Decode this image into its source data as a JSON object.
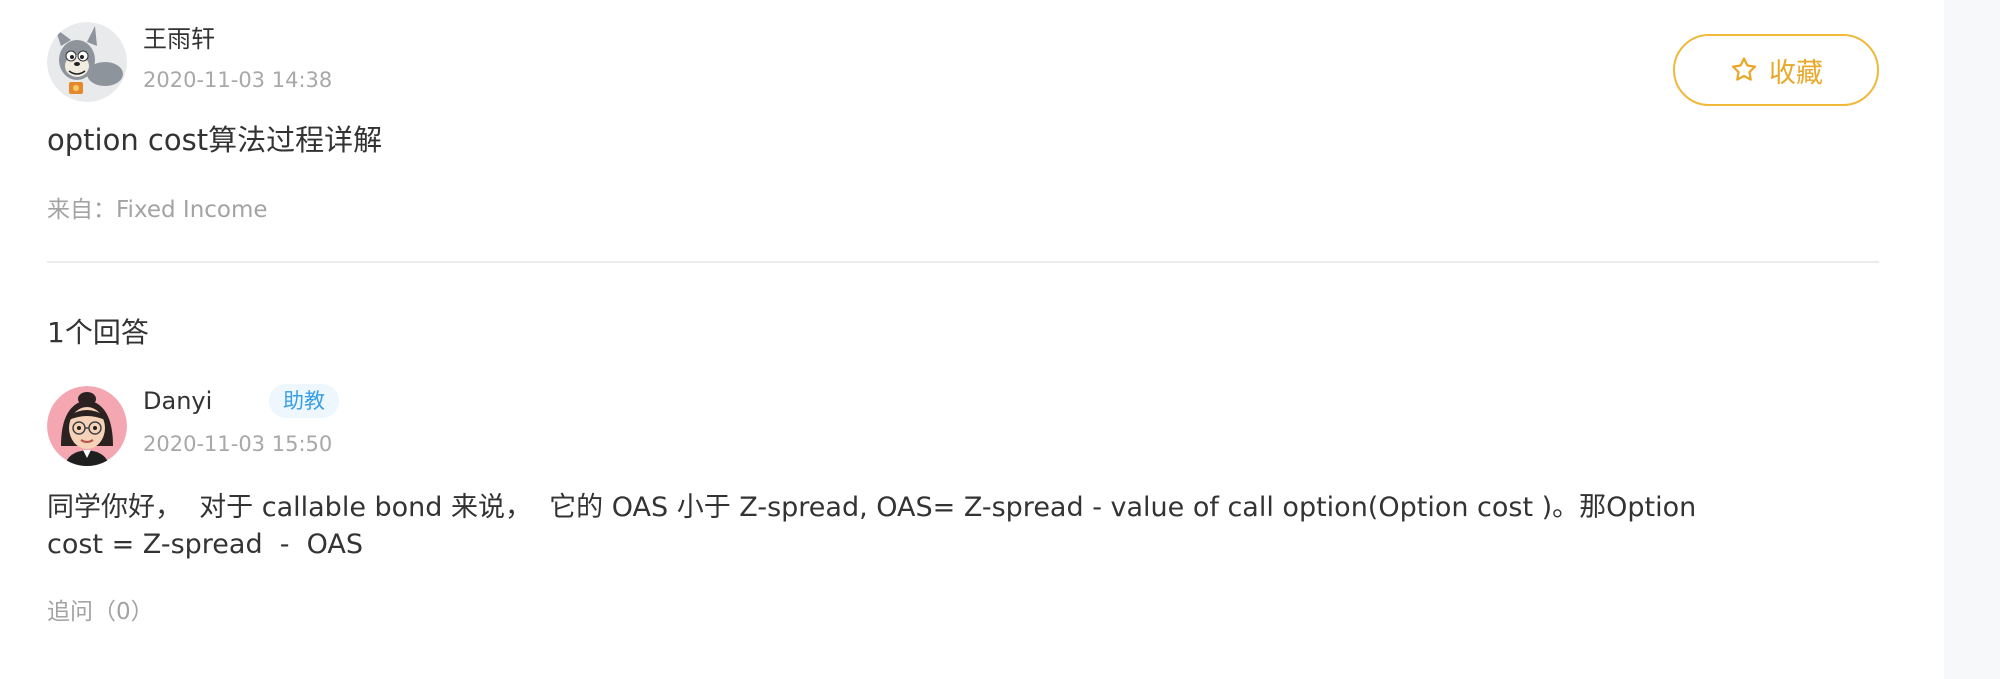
{
  "question": {
    "author": "王雨轩",
    "timestamp": "2020-11-03 14:38",
    "title": "option cost算法过程详解",
    "source": "来自：Fixed Income",
    "favorite_label": "收藏",
    "favorite_icon": "star-outline-icon"
  },
  "answers_header": "1个回答",
  "answer": {
    "author": "Danyi",
    "role_badge": "助教",
    "timestamp": "2020-11-03 15:50",
    "body_lines": [
      "同学你好，  对于 callable bond 来说，  它的 OAS 小于 Z-spread, OAS= Z-spread - value of call option(Option cost )。那Option",
      "cost = Z-spread  -  OAS"
    ],
    "follow_up": "追问（0）"
  },
  "colors": {
    "accent": "#f0b93a",
    "badge_text": "#3aa0e6",
    "badge_bg": "#eef7fd",
    "muted_text": "#a8a8a8",
    "primary_text": "#333333",
    "divider": "#ececec"
  }
}
